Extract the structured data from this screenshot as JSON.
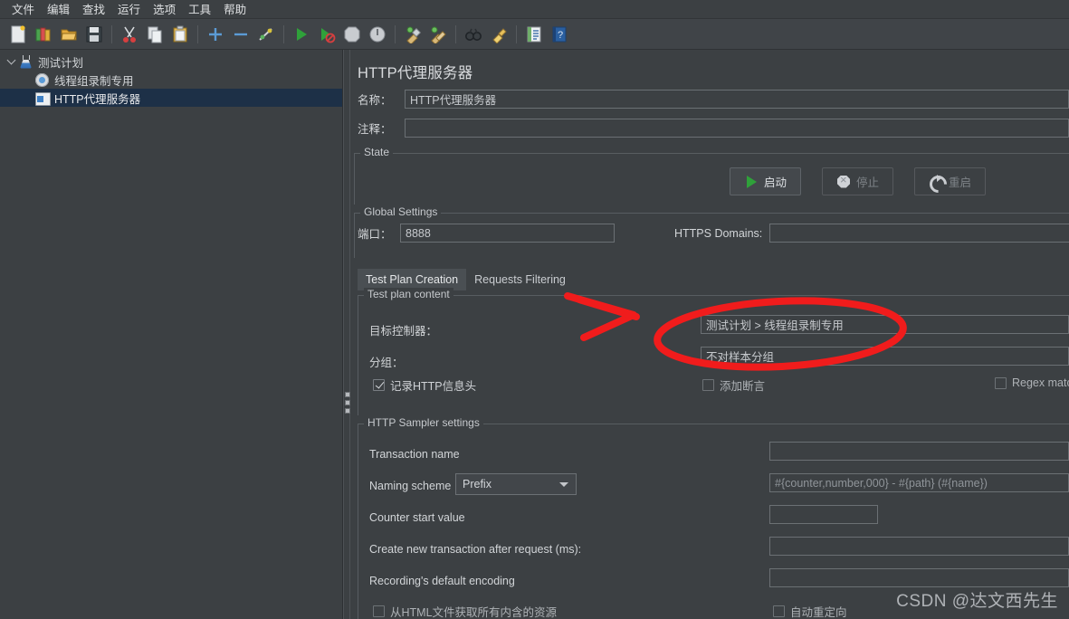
{
  "menubar": {
    "items": [
      {
        "label": "文件",
        "name": "menu-file"
      },
      {
        "label": "编辑",
        "name": "menu-edit"
      },
      {
        "label": "查找",
        "name": "menu-search"
      },
      {
        "label": "运行",
        "name": "menu-run"
      },
      {
        "label": "选项",
        "name": "menu-options"
      },
      {
        "label": "工具",
        "name": "menu-tools"
      },
      {
        "label": "帮助",
        "name": "menu-help"
      }
    ]
  },
  "toolbar": {
    "buttons": [
      {
        "icon": "new-file-icon"
      },
      {
        "icon": "open-templates-icon"
      },
      {
        "icon": "open-folder-icon"
      },
      {
        "icon": "save-icon"
      },
      {
        "sep": true
      },
      {
        "icon": "cut-icon"
      },
      {
        "icon": "copy-icon"
      },
      {
        "icon": "paste-icon"
      },
      {
        "sep": true
      },
      {
        "icon": "expand-all-icon"
      },
      {
        "icon": "collapse-all-icon"
      },
      {
        "icon": "toggle-icon"
      },
      {
        "sep": true
      },
      {
        "icon": "start-icon"
      },
      {
        "icon": "start-no-timers-icon"
      },
      {
        "icon": "stop-icon"
      },
      {
        "icon": "shutdown-icon"
      },
      {
        "sep": true
      },
      {
        "icon": "clear-icon"
      },
      {
        "icon": "clear-all-icon"
      },
      {
        "sep": true
      },
      {
        "icon": "search-icon"
      },
      {
        "icon": "reset-search-icon"
      },
      {
        "sep": true
      },
      {
        "icon": "function-helper-icon"
      },
      {
        "icon": "help-icon"
      }
    ]
  },
  "tree": {
    "nodes": [
      {
        "label": "测试计划",
        "icon": "test-plan-icon",
        "depth": 0,
        "expanded": true,
        "selected": false,
        "name": "tree-node-test-plan"
      },
      {
        "label": "线程组录制专用",
        "icon": "thread-group-icon",
        "depth": 1,
        "expanded": false,
        "selected": false,
        "name": "tree-node-thread-group"
      },
      {
        "label": "HTTP代理服务器",
        "icon": "http-proxy-icon",
        "depth": 1,
        "expanded": false,
        "selected": true,
        "name": "tree-node-http-proxy"
      }
    ]
  },
  "main": {
    "panel_title": "HTTP代理服务器",
    "name_label": "名称：",
    "name_value": "HTTP代理服务器",
    "comment_label": "注释：",
    "comment_value": "",
    "state_group": "State",
    "buttons": {
      "start": "启动",
      "stop": "停止",
      "restart": "重启"
    },
    "global_settings_group": "Global Settings",
    "port_label": "端口：",
    "port_value": "8888",
    "https_domains_label": "HTTPS Domains:",
    "https_domains_value": "",
    "tabs": [
      {
        "label": "Test Plan Creation",
        "active": true,
        "name": "tab-test-plan-creation"
      },
      {
        "label": "Requests Filtering",
        "active": false,
        "name": "tab-requests-filtering"
      }
    ],
    "test_plan_content_group": "Test plan content",
    "target_controller_label": "目标控制器：",
    "target_controller_value": "测试计划 > 线程组录制专用",
    "grouping_label": "分组：",
    "grouping_value": "不对样本分组",
    "capture_headers": {
      "label": "记录HTTP信息头",
      "checked": true
    },
    "add_assertions": {
      "label": "添加断言",
      "checked": false
    },
    "regex_matching": {
      "label": "Regex matc",
      "checked": false
    },
    "sampler_settings_group": "HTTP Sampler settings",
    "transaction_name_label": "Transaction name",
    "transaction_name_value": "",
    "naming_scheme_label": "Naming scheme",
    "naming_scheme_value": "Prefix",
    "naming_pattern_placeholder": "#{counter,number,000} - #{path} (#{name})",
    "counter_start_label": "Counter start value",
    "counter_start_value": "",
    "create_new_transaction_label": "Create new transaction after request (ms):",
    "create_new_transaction_value": "",
    "default_encoding_label": "Recording's default encoding",
    "default_encoding_value": "",
    "retrieve_embedded": {
      "label": "从HTML文件获取所有内含的资源",
      "checked": false
    },
    "follow_redirects": {
      "label": "自动重定向",
      "checked": false
    }
  },
  "annotation": {
    "color": "#f01c1c",
    "shapes": [
      "arrow-pointing-right",
      "ellipse-highlight"
    ]
  },
  "watermark": {
    "text": "CSDN @达文西先生"
  }
}
